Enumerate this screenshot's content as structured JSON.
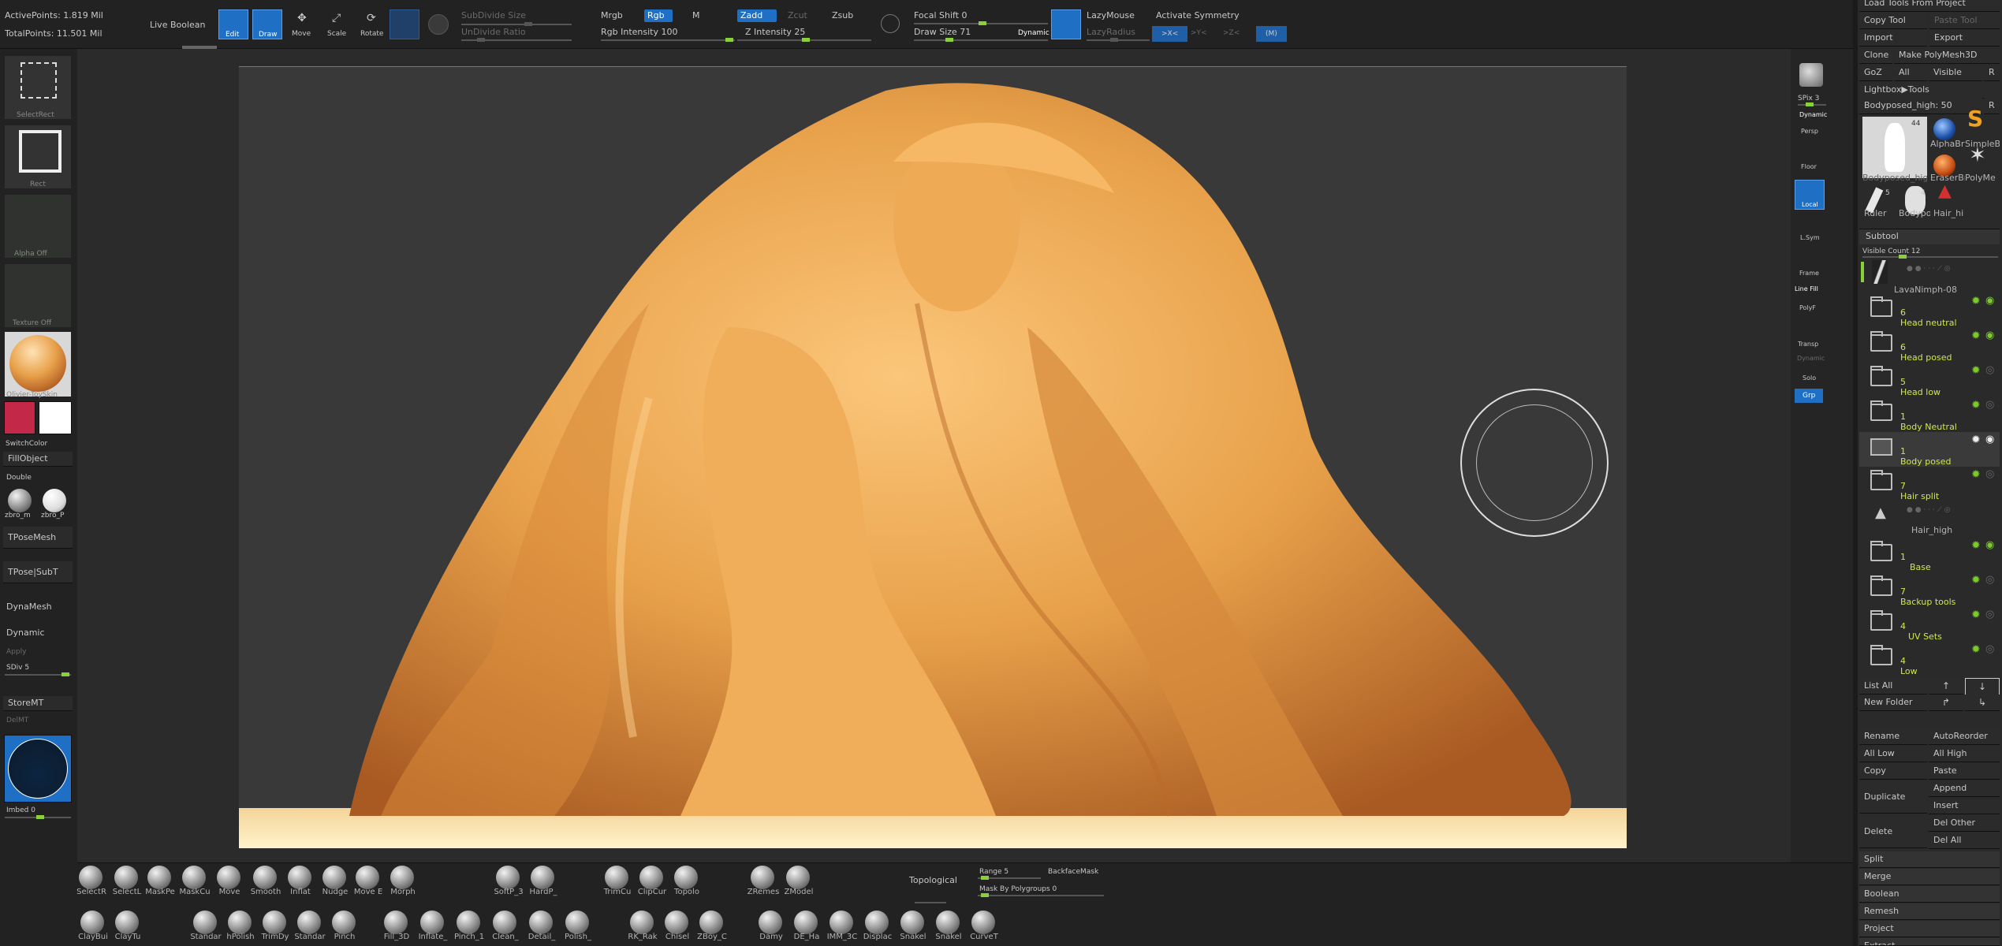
{
  "top_bar": {
    "active_points": "ActivePoints: 1.819 Mil",
    "total_points": "TotalPoints: 11.501 Mil",
    "live_boolean": "Live Boolean",
    "edit": "Edit",
    "draw": "Draw",
    "move": "Move",
    "scale": "Scale",
    "rotate": "Rotate",
    "subdivide_size": "SubDivide Size",
    "undivide_ratio": "UnDivide Ratio",
    "mrgb": "Mrgb",
    "rgb": "Rgb",
    "m": "M",
    "rgb_intensity": "Rgb Intensity 100",
    "zadd": "Zadd",
    "zcut": "Zcut",
    "zsub": "Zsub",
    "z_intensity": "Z Intensity 25",
    "focal_shift": "Focal Shift 0",
    "draw_size": "Draw Size 71",
    "dynamic": "Dynamic",
    "lazymouse": "LazyMouse",
    "lazyradius": "LazyRadius",
    "activate_symmetry": "Activate Symmetry",
    "sym_x": ">X<",
    "sym_y": ">Y<",
    "sym_z": ">Z<",
    "sym_m": "(M)"
  },
  "left_panel": {
    "select_rect": "SelectRect",
    "rect": "Rect",
    "alpha_off": "Alpha Off",
    "texture_off": "Texture Off",
    "material": "Olivier-ToySkin",
    "switch_color": "SwitchColor",
    "fill_object": "FillObject",
    "double": "Double",
    "mat1": "zbro_m",
    "mat2": "zbro_P",
    "tpose_mesh": "TPoseMesh",
    "tpose_subt": "TPose|SubT",
    "dynamesh": "DynaMesh",
    "dynamic": "Dynamic",
    "apply": "Apply",
    "sdiv": "SDiv 5",
    "storemt": "StoreMT",
    "delmt": "DelMT",
    "imbed": "Imbed 0"
  },
  "right_tools": {
    "spix": "SPix 3",
    "dynamic": "Dynamic",
    "persp": "Persp",
    "floor": "Floor",
    "local": "Local",
    "lsym": "L.Sym",
    "frame": "Frame",
    "line_fill": "Line Fill",
    "polyf": "PolyF",
    "transp": "Transp",
    "dynamic2": "Dynamic",
    "solo": "Solo",
    "grp": "Grp"
  },
  "tool_panel": {
    "load_tools": "Load Tools From Project",
    "copy_tool": "Copy Tool",
    "paste_tool": "Paste Tool",
    "import": "Import",
    "export": "Export",
    "clone": "Clone",
    "make_polymesh": "Make PolyMesh3D",
    "goz": "GoZ",
    "all": "All",
    "visible": "Visible",
    "r": "R",
    "lightbox_tools": "Lightbox▶Tools",
    "current_tool": "Bodyposed_high: 50",
    "r2": "R",
    "count44": "44",
    "count5": "5",
    "count4": "4",
    "thumbs": [
      "Bodyposed_hig",
      "AlphaBr",
      "SimpleB",
      "EraserBr",
      "PolyMe",
      "Ruler",
      "Bodypo",
      "Hair_hi"
    ],
    "subtool": "Subtool",
    "visible_count": "Visible Count 12",
    "subtools": [
      {
        "count": "",
        "name": "LavaNimph-08"
      },
      {
        "count": "6",
        "name": "Head neutral"
      },
      {
        "count": "6",
        "name": "Head posed"
      },
      {
        "count": "5",
        "name": "Head low"
      },
      {
        "count": "1",
        "name": "Body Neutral"
      },
      {
        "count": "1",
        "name": "Body posed"
      },
      {
        "count": "7",
        "name": "Hair split"
      },
      {
        "count": "",
        "name": "Hair_high"
      },
      {
        "count": "1",
        "name": "Base"
      },
      {
        "count": "7",
        "name": "Backup tools"
      },
      {
        "count": "4",
        "name": "UV Sets"
      },
      {
        "count": "4",
        "name": "Low"
      }
    ],
    "list_all": "List All",
    "new_folder": "New Folder",
    "rename": "Rename",
    "auto_reorder": "AutoReorder",
    "all_low": "All Low",
    "all_high": "All High",
    "copy": "Copy",
    "paste": "Paste",
    "duplicate": "Duplicate",
    "append": "Append",
    "insert": "Insert",
    "delete": "Delete",
    "del_other": "Del Other",
    "del_all": "Del All",
    "split": "Split",
    "merge": "Merge",
    "boolean": "Boolean",
    "remesh": "Remesh",
    "project": "Project",
    "extract": "Extract"
  },
  "bottom_bar": {
    "row1": [
      "SelectR",
      "SelectL",
      "MaskPe",
      "MaskCu",
      "Move",
      "Smooth",
      "Inflat",
      "Nudge",
      "Move E",
      "Morph",
      "SoftP_3",
      "HardP_",
      "TrimCu",
      "ClipCur",
      "Topolo",
      "ZRemes",
      "ZModel"
    ],
    "topological": "Topological",
    "range": "Range 5",
    "backface_mask": "BackfaceMask",
    "mask_by_polygroups": "Mask By Polygroups 0",
    "row2": [
      "ClayBui",
      "ClayTu",
      "Standar",
      "hPolish",
      "TrimDy",
      "Standar",
      "Pinch",
      "Fill_3D",
      "Inflate_",
      "Pinch_1",
      "Clean_",
      "Detail_",
      "Polish_",
      "RK_Rak",
      "Chisel",
      "ZBoy_C",
      "Damy",
      "DE_Ha",
      "IMM_3C",
      "Displac",
      "Snakel",
      "Snakel",
      "CurveT"
    ]
  },
  "colors": {
    "accent": "#1f6fc4",
    "clay": "#e8a14a",
    "highlight": "#cfe84a",
    "primary_color": "#c42848",
    "secondary_color": "#ffffff"
  }
}
